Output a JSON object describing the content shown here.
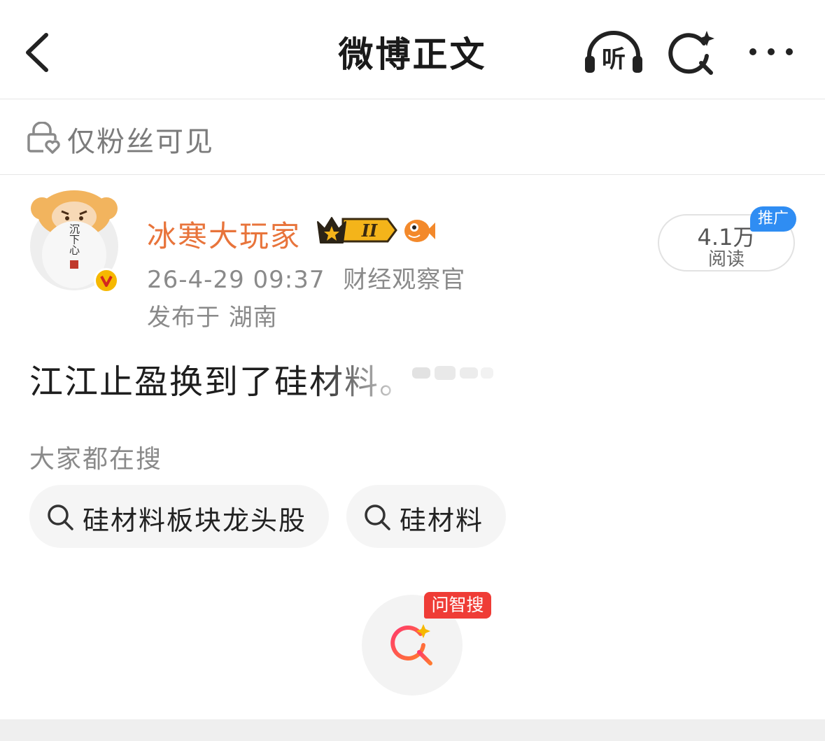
{
  "header": {
    "title": "微博正文",
    "listen_label": "听"
  },
  "visibility": {
    "label": "仅粉丝可见"
  },
  "author": {
    "name": "冰寒大玩家",
    "avatar_text": "沉下心",
    "level_badge": "II",
    "verified_mark": "V",
    "timestamp": "26-4-29 09:37",
    "category": "财经观察官",
    "location": "发布于 湖南"
  },
  "reads": {
    "count": "4.1万",
    "label": "阅读",
    "promo_tag": "推广"
  },
  "post": {
    "text": "江江止盈换到了硅材料。"
  },
  "trending": {
    "title": "大家都在搜",
    "items": [
      {
        "label": "硅材料板块龙头股"
      },
      {
        "label": "硅材料"
      }
    ]
  },
  "ask": {
    "tag": "问智搜"
  },
  "colors": {
    "author_name": "#e8743b",
    "promo_tag_bg": "#2f8df3",
    "ask_tag_bg": "#ef3c36",
    "verified_badge": "#f6b800"
  },
  "icons": [
    "back-arrow-icon",
    "headphones-icon",
    "ai-search-icon",
    "more-dots-icon",
    "lock-heart-icon",
    "search-icon",
    "crown-icon",
    "fish-icon",
    "verified-icon"
  ]
}
